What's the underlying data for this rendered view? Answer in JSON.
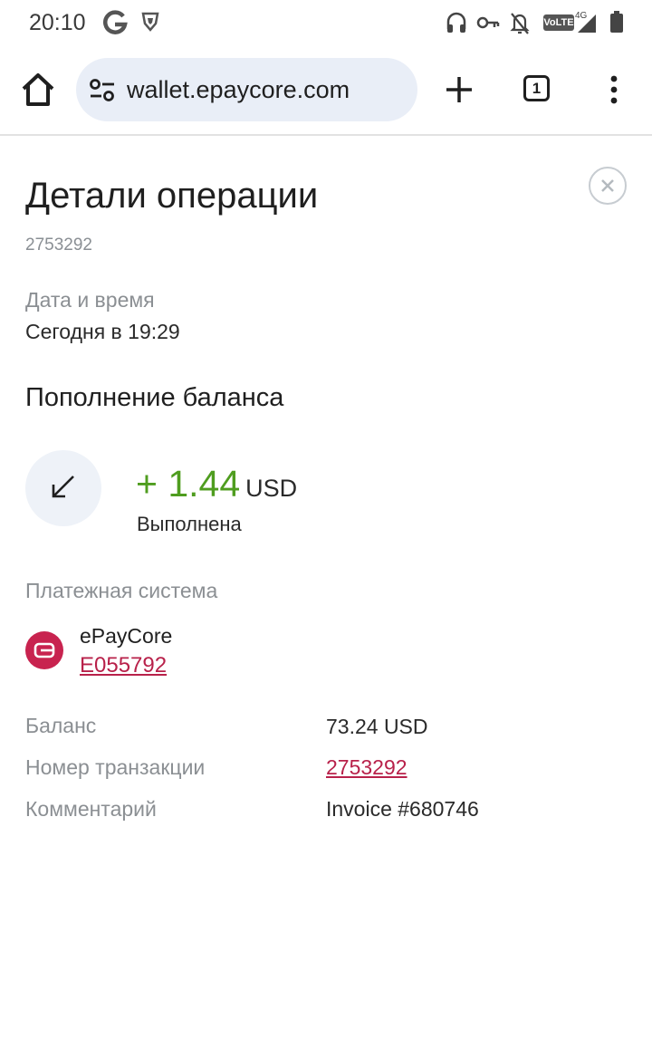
{
  "status_bar": {
    "time": "20:10",
    "icons": [
      "google-icon",
      "shield-icon",
      "headphones-icon",
      "key-icon",
      "bell-off-icon",
      "volte-icon",
      "signal-icon",
      "battery-icon"
    ],
    "volte": "VoLTE",
    "network": "4G"
  },
  "browser": {
    "url": "wallet.epaycore.com",
    "tabs_count": "1"
  },
  "details": {
    "title": "Детали операции",
    "operation_id": "2753292",
    "datetime_label": "Дата и время",
    "datetime_value": "Сегодня в 19:29",
    "operation_type": "Пополнение баланса",
    "amount": "+ 1.44",
    "currency": "USD",
    "status": "Выполнена",
    "payment_system_label": "Платежная система",
    "payment_system_name": "ePayCore",
    "payment_account": "E055792",
    "rows": [
      {
        "label": "Баланс",
        "value": "73.24 USD"
      },
      {
        "label": "Номер транзакции",
        "value": "2753292"
      },
      {
        "label": "Комментарий",
        "value": "Invoice #680746"
      }
    ]
  },
  "colors": {
    "accent_link": "#b8214a",
    "amount_positive": "#4f9d1f",
    "brand": "#c8234f"
  }
}
